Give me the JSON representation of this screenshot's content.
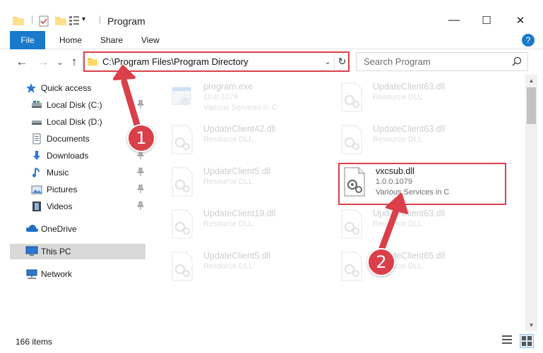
{
  "window": {
    "title": "Program",
    "minimize_glyph": "—",
    "maximize_glyph": "☐",
    "close_glyph": "✕"
  },
  "ribbon": {
    "tabs": [
      "File",
      "Home",
      "Share",
      "View"
    ]
  },
  "navbar": {
    "back_glyph": "←",
    "forward_glyph": "→",
    "recent_glyph": "⌄",
    "up_glyph": "↑",
    "address": "C:\\Program Files\\Program Directory",
    "address_dropdown_glyph": "⌄",
    "refresh_glyph": "↻",
    "search_placeholder": "Search Program"
  },
  "sidebar": {
    "items": [
      {
        "label": "Quick access",
        "icon": "star-icon",
        "pinned": false
      },
      {
        "label": "Local Disk (C:)",
        "icon": "drive-icon",
        "pinned": true
      },
      {
        "label": "Local Disk (D:)",
        "icon": "drive-icon",
        "pinned": true
      },
      {
        "label": "Documents",
        "icon": "documents-icon",
        "pinned": true
      },
      {
        "label": "Downloads",
        "icon": "downloads-icon",
        "pinned": true
      },
      {
        "label": "Music",
        "icon": "music-icon",
        "pinned": true
      },
      {
        "label": "Pictures",
        "icon": "pictures-icon",
        "pinned": true
      },
      {
        "label": "Videos",
        "icon": "videos-icon",
        "pinned": true
      },
      {
        "label": "OneDrive",
        "icon": "onedrive-icon",
        "pinned": false
      },
      {
        "label": "This PC",
        "icon": "pc-icon",
        "pinned": false,
        "selected": true
      },
      {
        "label": "Network",
        "icon": "network-icon",
        "pinned": false
      }
    ],
    "pin_glyph": "📌"
  },
  "files": [
    {
      "name": "program.exe",
      "version": "10.0.1079",
      "desc": "Various Services in C",
      "faded": true,
      "kind": "exe"
    },
    {
      "name": "UpdateClient63.dll",
      "version": "Resource DLL",
      "desc": "",
      "faded": true,
      "kind": "dll"
    },
    {
      "name": "UpdateClient42.dll",
      "version": "Resource DLL",
      "desc": "",
      "faded": true,
      "kind": "dll"
    },
    {
      "name": "UpdateClient63.dll",
      "version": "Resource DLL",
      "desc": "",
      "faded": true,
      "kind": "dll"
    },
    {
      "name": "UpdateClient5.dll",
      "version": "Resource DLL",
      "desc": "",
      "faded": true,
      "kind": "dll"
    },
    {
      "name": "vxcsub.dll",
      "version": "1.0.0.1079",
      "desc": "Various Services in C",
      "faded": false,
      "kind": "dll"
    },
    {
      "name": "UpdateClient19.dll",
      "version": "Resource DLL",
      "desc": "",
      "faded": true,
      "kind": "dll"
    },
    {
      "name": "UpdateClient63.dll",
      "version": "Resource DLL",
      "desc": "",
      "faded": true,
      "kind": "dll"
    },
    {
      "name": "UpdateClient5.dll",
      "version": "Resource DLL",
      "desc": "",
      "faded": true,
      "kind": "dll"
    },
    {
      "name": "UpdateClient65.dll",
      "version": "Resource DLL",
      "desc": "",
      "faded": true,
      "kind": "dll"
    }
  ],
  "statusbar": {
    "count": "166 items"
  },
  "annotations": {
    "marker1": "1",
    "marker2": "2",
    "color": "#d9404a"
  }
}
